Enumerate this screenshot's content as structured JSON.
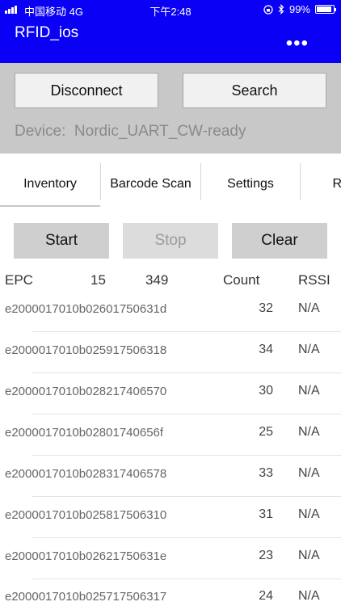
{
  "status_bar": {
    "carrier": "中国移动  4G",
    "time": "下午2:48",
    "battery": "99%",
    "battery_level": 0.99,
    "icons": [
      "signal-icon",
      "lock-rotation-icon",
      "bluetooth-icon",
      "battery-icon"
    ]
  },
  "nav": {
    "title": "RFID_ios",
    "more": "•••"
  },
  "panel": {
    "disconnect_label": "Disconnect",
    "search_label": "Search",
    "device_label": "Device:",
    "device_name": "Nordic_UART_CW-ready"
  },
  "tabs": [
    {
      "label": "Inventory",
      "selected": true
    },
    {
      "label": "Barcode Scan",
      "selected": false
    },
    {
      "label": "Settings",
      "selected": false
    },
    {
      "label": "R",
      "selected": false
    }
  ],
  "controls": {
    "start_label": "Start",
    "stop_label": "Stop",
    "clear_label": "Clear"
  },
  "table": {
    "headers": {
      "epc": "EPC",
      "unique_count": "15",
      "total_count": "349",
      "count": "Count",
      "rssi": "RSSI"
    },
    "rows": [
      {
        "epc": "e2000017010b02601750631d",
        "count": "32",
        "rssi": "N/A"
      },
      {
        "epc": "e2000017010b025917506318",
        "count": "34",
        "rssi": "N/A"
      },
      {
        "epc": "e2000017010b028217406570",
        "count": "30",
        "rssi": "N/A"
      },
      {
        "epc": "e2000017010b02801740656f",
        "count": "25",
        "rssi": "N/A"
      },
      {
        "epc": "e2000017010b028317406578",
        "count": "33",
        "rssi": "N/A"
      },
      {
        "epc": "e2000017010b025817506310",
        "count": "31",
        "rssi": "N/A"
      },
      {
        "epc": "e2000017010b02621750631e",
        "count": "23",
        "rssi": "N/A"
      },
      {
        "epc": "e2000017010b025717506317",
        "count": "24",
        "rssi": "N/A"
      }
    ]
  },
  "colors": {
    "nav_blue": "#0a00f5",
    "panel_gray": "#c8c8c8",
    "button_gray": "#cfcfcf"
  }
}
